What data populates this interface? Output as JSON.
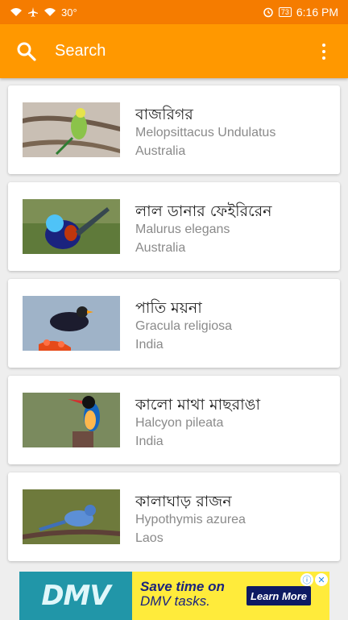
{
  "status_bar": {
    "temperature": "30°",
    "battery": "73",
    "time": "6:16 PM"
  },
  "app_bar": {
    "search_label": "Search",
    "search_icon": "search-icon",
    "menu_icon": "more-vert-icon"
  },
  "birds": [
    {
      "name": "বাজরিগর",
      "scientific": "Melopsittacus Undulatus",
      "location": "Australia"
    },
    {
      "name": "লাল ডানার ফেইরিরেন",
      "scientific": "Malurus elegans",
      "location": "Australia"
    },
    {
      "name": "পাতি ময়না",
      "scientific": "Gracula religiosa",
      "location": "India"
    },
    {
      "name": "কালো মাথা মাছরাঙা",
      "scientific": "Halcyon pileata",
      "location": "India"
    },
    {
      "name": "কালাঘাড় রাজন",
      "scientific": "Hypothymis azurea",
      "location": "Laos"
    }
  ],
  "ad": {
    "brand": "DMV",
    "headline_1": "Save time on",
    "headline_2": "DMV tasks.",
    "cta": "Learn More"
  },
  "colors": {
    "status_bar": "#f57c00",
    "app_bar": "#ff9800",
    "background": "#eeeeee"
  }
}
